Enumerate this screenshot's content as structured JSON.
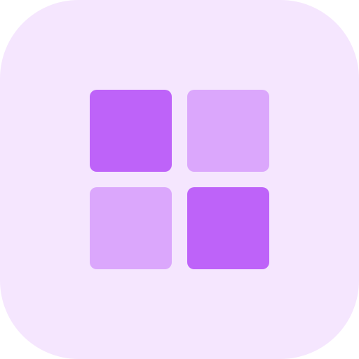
{
  "icon": {
    "name": "grid-icon",
    "colors": {
      "background": "#f5e6fe",
      "primary": "#be63f9",
      "secondary": "#dba7fc"
    },
    "cells": [
      {
        "position": "top-left",
        "tone": "primary"
      },
      {
        "position": "top-right",
        "tone": "secondary"
      },
      {
        "position": "bottom-left",
        "tone": "secondary"
      },
      {
        "position": "bottom-right",
        "tone": "primary"
      }
    ]
  }
}
